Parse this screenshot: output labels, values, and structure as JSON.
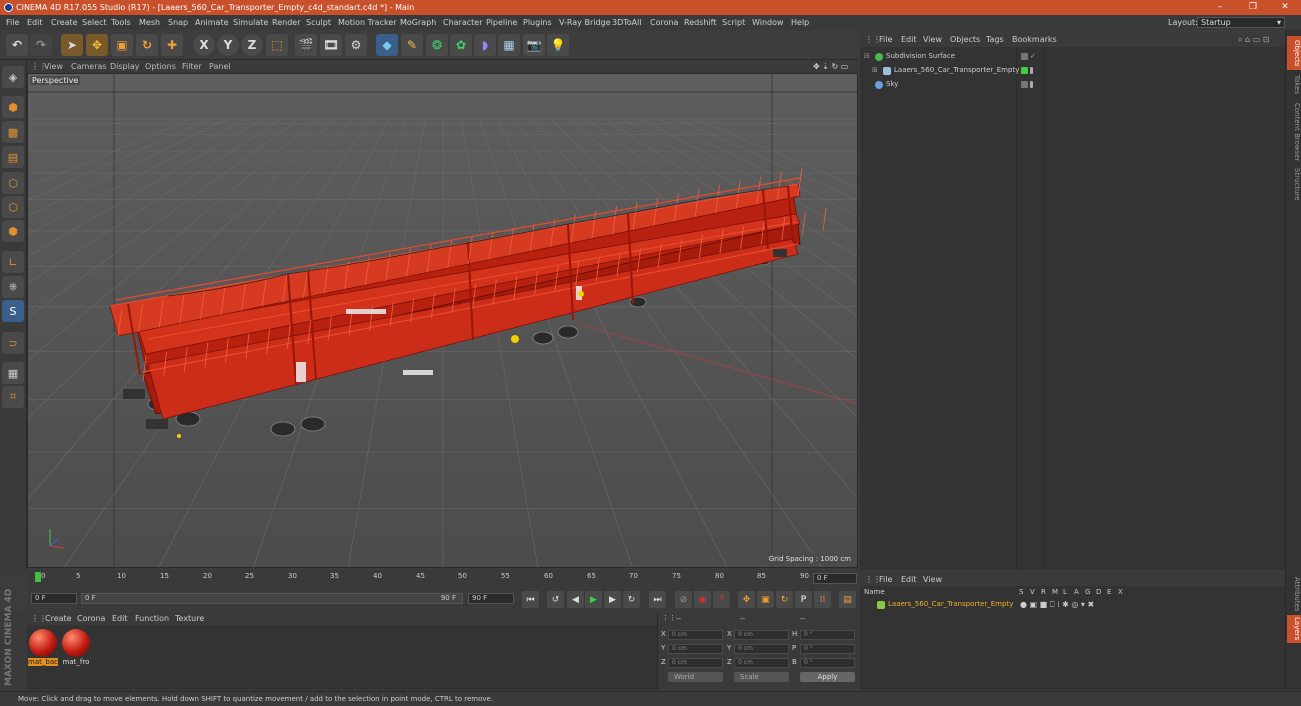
{
  "window": {
    "title": "CINEMA 4D R17.055 Studio (R17) - [Laaers_560_Car_Transporter_Empty_c4d_standart.c4d *] - Main",
    "controls": [
      "–",
      "❐",
      "✕"
    ]
  },
  "menubar": {
    "items": [
      "File",
      "Edit",
      "Create",
      "Select",
      "Tools",
      "Mesh",
      "Snap",
      "Animate",
      "Simulate",
      "Render",
      "Sculpt",
      "Motion Tracker",
      "MoGraph",
      "Character",
      "Pipeline",
      "Plugins",
      "V-Ray Bridge",
      "3DToAll",
      "Corona",
      "Redshift",
      "Script",
      "Window",
      "Help"
    ],
    "layout_label": "Layout:",
    "layout_value": "Startup"
  },
  "toolbar": {
    "icons": [
      "undo-icon",
      "redo-icon",
      "select-arrow-icon",
      "move-icon",
      "scale-icon",
      "rotate-icon",
      "add-icon",
      "x-axis-icon",
      "y-axis-icon",
      "z-axis-icon",
      "coordinate-system-icon",
      "render-view-icon",
      "render-picture-viewer-icon",
      "render-settings-icon",
      "cube-icon",
      "pen-icon",
      "subdivision-icon",
      "cloner-icon",
      "deformer-icon",
      "floor-icon",
      "camera-icon",
      "light-icon"
    ],
    "axis_labels": [
      "X",
      "Y",
      "Z"
    ]
  },
  "leftbar": {
    "icons": [
      "make-editable-icon",
      "model-mode-icon",
      "texture-mode-icon",
      "workplane-icon",
      "points-mode-icon",
      "edges-mode-icon",
      "polygons-mode-icon",
      "axis-mode-icon",
      "tweak-icon",
      "solo-icon",
      "magnet-icon",
      "snap-grid-icon",
      "snap-settings-icon"
    ]
  },
  "viewport": {
    "menu": [
      "View",
      "Cameras",
      "Display",
      "Options",
      "Filter",
      "Panel"
    ],
    "label": "Perspective",
    "grid_spacing": "Grid Spacing : 1000 cm",
    "model_color": "#c82a18",
    "background_color": "#545454"
  },
  "timeline": {
    "ticks": [
      "0",
      "5",
      "10",
      "15",
      "20",
      "25",
      "30",
      "35",
      "40",
      "45",
      "50",
      "55",
      "60",
      "65",
      "70",
      "75",
      "80",
      "85",
      "90"
    ],
    "current_frame": "0 F"
  },
  "transport": {
    "start": "0 F",
    "range_start": "0 F",
    "range_end": "90 F",
    "end": "90 F"
  },
  "material_manager": {
    "menu": [
      "Create",
      "Corona",
      "Edit",
      "Function",
      "Texture"
    ],
    "materials": [
      {
        "name": "mat_bac",
        "selected": true
      },
      {
        "name": "mat_fro",
        "selected": false
      }
    ],
    "brand": "MAXON CINEMA 4D"
  },
  "coordinates": {
    "headers": [
      "--",
      "--",
      "--"
    ],
    "rows": [
      {
        "axis": "X",
        "pos": "0 cm",
        "axis2": "X",
        "size": "0 cm",
        "axis3": "H",
        "rot": "0 °"
      },
      {
        "axis": "Y",
        "pos": "0 cm",
        "axis2": "Y",
        "size": "0 cm",
        "axis3": "P",
        "rot": "0 °"
      },
      {
        "axis": "Z",
        "pos": "0 cm",
        "axis2": "Z",
        "size": "0 cm",
        "axis3": "B",
        "rot": "0 °"
      }
    ],
    "world": "World",
    "scale": "Scale",
    "apply": "Apply"
  },
  "object_manager": {
    "menu": [
      "File",
      "Edit",
      "View",
      "Objects",
      "Tags",
      "Bookmarks"
    ],
    "objects": [
      {
        "name": "Subdivision Surface",
        "icon": "subdivision-icon",
        "color": "#4ab84a"
      },
      {
        "name": "Laaers_560_Car_Transporter_Empty",
        "icon": "null-object-icon",
        "color": "#9ac0e0"
      },
      {
        "name": "Sky",
        "icon": "sky-icon",
        "color": "#6aa0e0"
      }
    ]
  },
  "layer_manager": {
    "menu": [
      "File",
      "Edit",
      "View"
    ],
    "headers": [
      "Name",
      "S",
      "V",
      "R",
      "M",
      "L",
      "A",
      "G",
      "D",
      "E",
      "X"
    ],
    "rows": [
      {
        "name": "Laaers_560_Car_Transporter_Empty",
        "color": "#8ac840"
      }
    ]
  },
  "right_tabs": {
    "top": [
      "Objects",
      "Takes",
      "Content Browser",
      "Structure"
    ],
    "bottom": [
      "Attributes",
      "Layers"
    ]
  },
  "statusbar": {
    "text": "Move: Click and drag to move elements. Hold down SHIFT to quantize movement / add to the selection in point mode, CTRL to remove."
  }
}
